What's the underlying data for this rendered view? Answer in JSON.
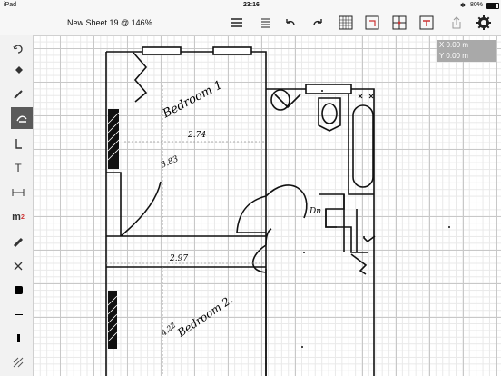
{
  "status": {
    "device": "iPad",
    "time": "23:16",
    "battery": "80%"
  },
  "toolbar": {
    "title": "New Sheet 19 @ 146%"
  },
  "coords": {
    "x": "X 0.00 m",
    "y": "Y 0.00 m"
  },
  "sidebar_tools": [
    {
      "name": "undo-arc-tool",
      "glyph": "↶"
    },
    {
      "name": "fill-tool",
      "glyph": "◆"
    },
    {
      "name": "pencil-tool",
      "glyph": "✎"
    },
    {
      "name": "freehand-tool",
      "glyph": "✍"
    },
    {
      "name": "wall-tool",
      "glyph": "ℓ"
    },
    {
      "name": "text-tool",
      "glyph": "T"
    },
    {
      "name": "dimension-tool",
      "glyph": "⟷"
    },
    {
      "name": "area-tool",
      "glyph": "m²"
    },
    {
      "name": "ruler-tool",
      "glyph": "📏"
    },
    {
      "name": "delete-tool",
      "glyph": "✕"
    },
    {
      "name": "fill-color",
      "glyph": "●"
    },
    {
      "name": "line-thin",
      "glyph": "—"
    },
    {
      "name": "line-thick",
      "glyph": "❙"
    },
    {
      "name": "layers-tool",
      "glyph": "▨"
    }
  ],
  "drawing": {
    "bedroom1": "Bedroom 1",
    "bedroom1_width": "2.74",
    "bedroom1_depth": "3.83",
    "bedroom2": "Bedroom 2.",
    "bedroom2_width": "2.97",
    "bedroom2_depth": "4.22",
    "stairs": "Dn"
  }
}
